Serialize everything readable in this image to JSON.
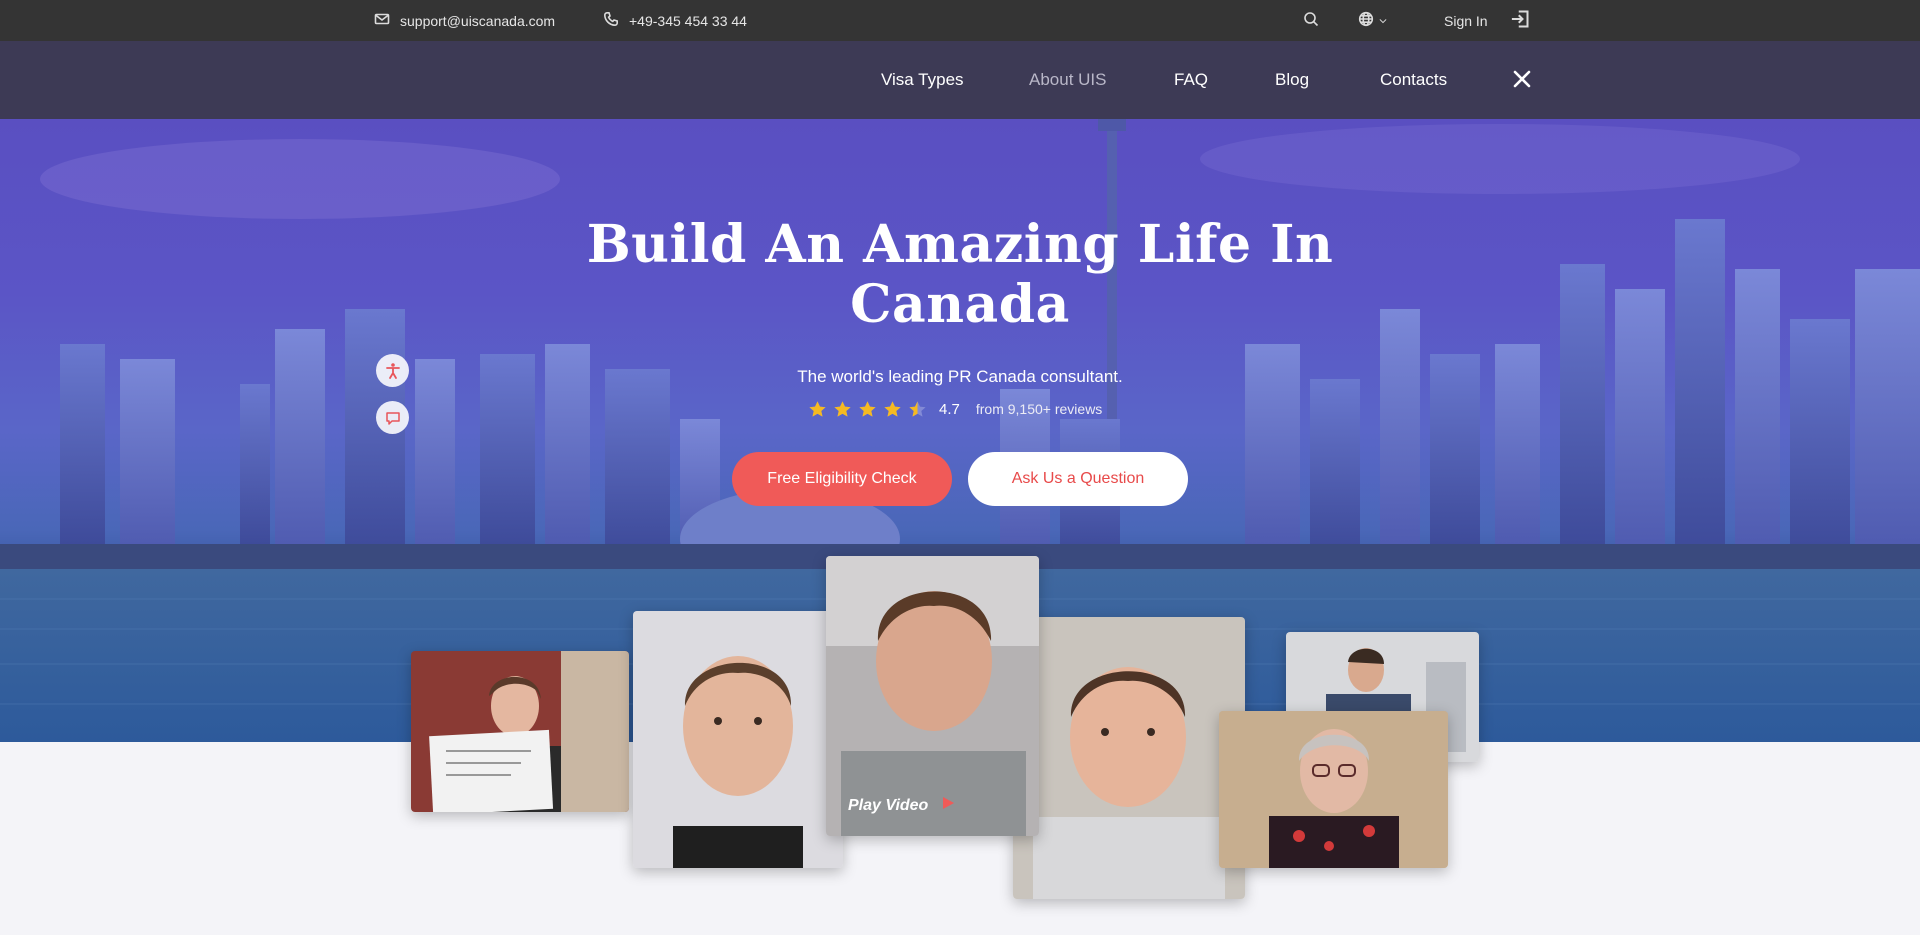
{
  "topbar": {
    "email": "support@uiscanada.com",
    "phone": "+49-345 454 33 44",
    "sign_in": "Sign In",
    "icons": [
      "mail-icon",
      "phone-icon",
      "search-icon",
      "globe-icon",
      "chevron-down-icon",
      "sign-in-icon"
    ]
  },
  "nav": {
    "items": [
      {
        "label": "Visa Types"
      },
      {
        "label": "About UIS"
      },
      {
        "label": "FAQ"
      },
      {
        "label": "Blog"
      },
      {
        "label": "Contacts"
      }
    ],
    "close_icon": "close-icon"
  },
  "hero": {
    "title_line1": "Build An Amazing Life In",
    "title_line2": "Canada",
    "subtitle": "The world's leading PR Canada consultant.",
    "rating": {
      "stars": 4.5,
      "score": "4.7",
      "reviews": "from 9,150+ reviews"
    },
    "primary_button": "Free Eligibility Check",
    "secondary_button": "Ask Us a Question",
    "side_icons": [
      "accessibility-icon",
      "chat-icon"
    ]
  },
  "videos": {
    "play_label": "Play Video"
  },
  "colors": {
    "topbar": "#343434",
    "nav": "#3d3a55",
    "accent": "#f05a58",
    "star": "#f5b922"
  }
}
